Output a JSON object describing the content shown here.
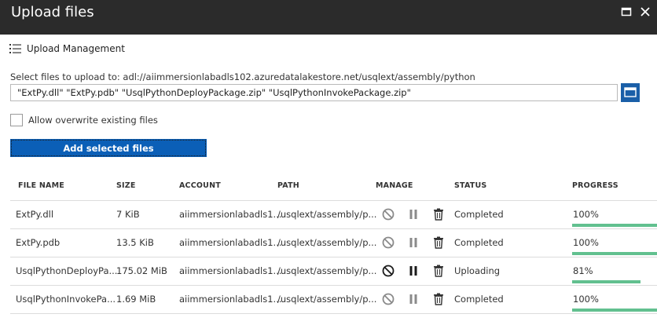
{
  "window": {
    "title": "Upload files"
  },
  "toolbar": {
    "upload_management_label": "Upload Management"
  },
  "upload": {
    "destination_label": "Select files to upload to: adl://aiimmersionlabadls102.azuredatalakestore.net/usqlext/assembly/python",
    "selected_files_value": "\"ExtPy.dll\" \"ExtPy.pdb\" \"UsqlPythonDeployPackage.zip\" \"UsqlPythonInvokePackage.zip\"",
    "overwrite_label": "Allow overwrite existing files",
    "overwrite_checked": false,
    "add_button_label": "Add selected files"
  },
  "table": {
    "columns": [
      "FILE NAME",
      "SIZE",
      "ACCOUNT",
      "PATH",
      "MANAGE",
      "STATUS",
      "PROGRESS"
    ],
    "rows": [
      {
        "file_name": "ExtPy.dll",
        "size": "7 KiB",
        "account": "aiimmersionlabadls1...",
        "path": "/usqlext/assembly/p...",
        "status": "Completed",
        "progress": "100%",
        "progress_fraction": 1.0,
        "active": false
      },
      {
        "file_name": "ExtPy.pdb",
        "size": "13.5 KiB",
        "account": "aiimmersionlabadls1...",
        "path": "/usqlext/assembly/p...",
        "status": "Completed",
        "progress": "100%",
        "progress_fraction": 1.0,
        "active": false
      },
      {
        "file_name": "UsqlPythonDeployPa...",
        "size": "175.02 MiB",
        "account": "aiimmersionlabadls1...",
        "path": "/usqlext/assembly/p...",
        "status": "Uploading",
        "progress": "81%",
        "progress_fraction": 0.81,
        "active": true
      },
      {
        "file_name": "UsqlPythonInvokePa...",
        "size": "1.69 MiB",
        "account": "aiimmersionlabadls1...",
        "path": "/usqlext/assembly/p...",
        "status": "Completed",
        "progress": "100%",
        "progress_fraction": 1.0,
        "active": false
      }
    ]
  },
  "colors": {
    "titlebar": "#2b2b2b",
    "accent_blue": "#0b5fb7",
    "progress_green": "#62c08f",
    "icon_disabled": "#8a8a8a",
    "icon_active": "#1a1a1a"
  }
}
